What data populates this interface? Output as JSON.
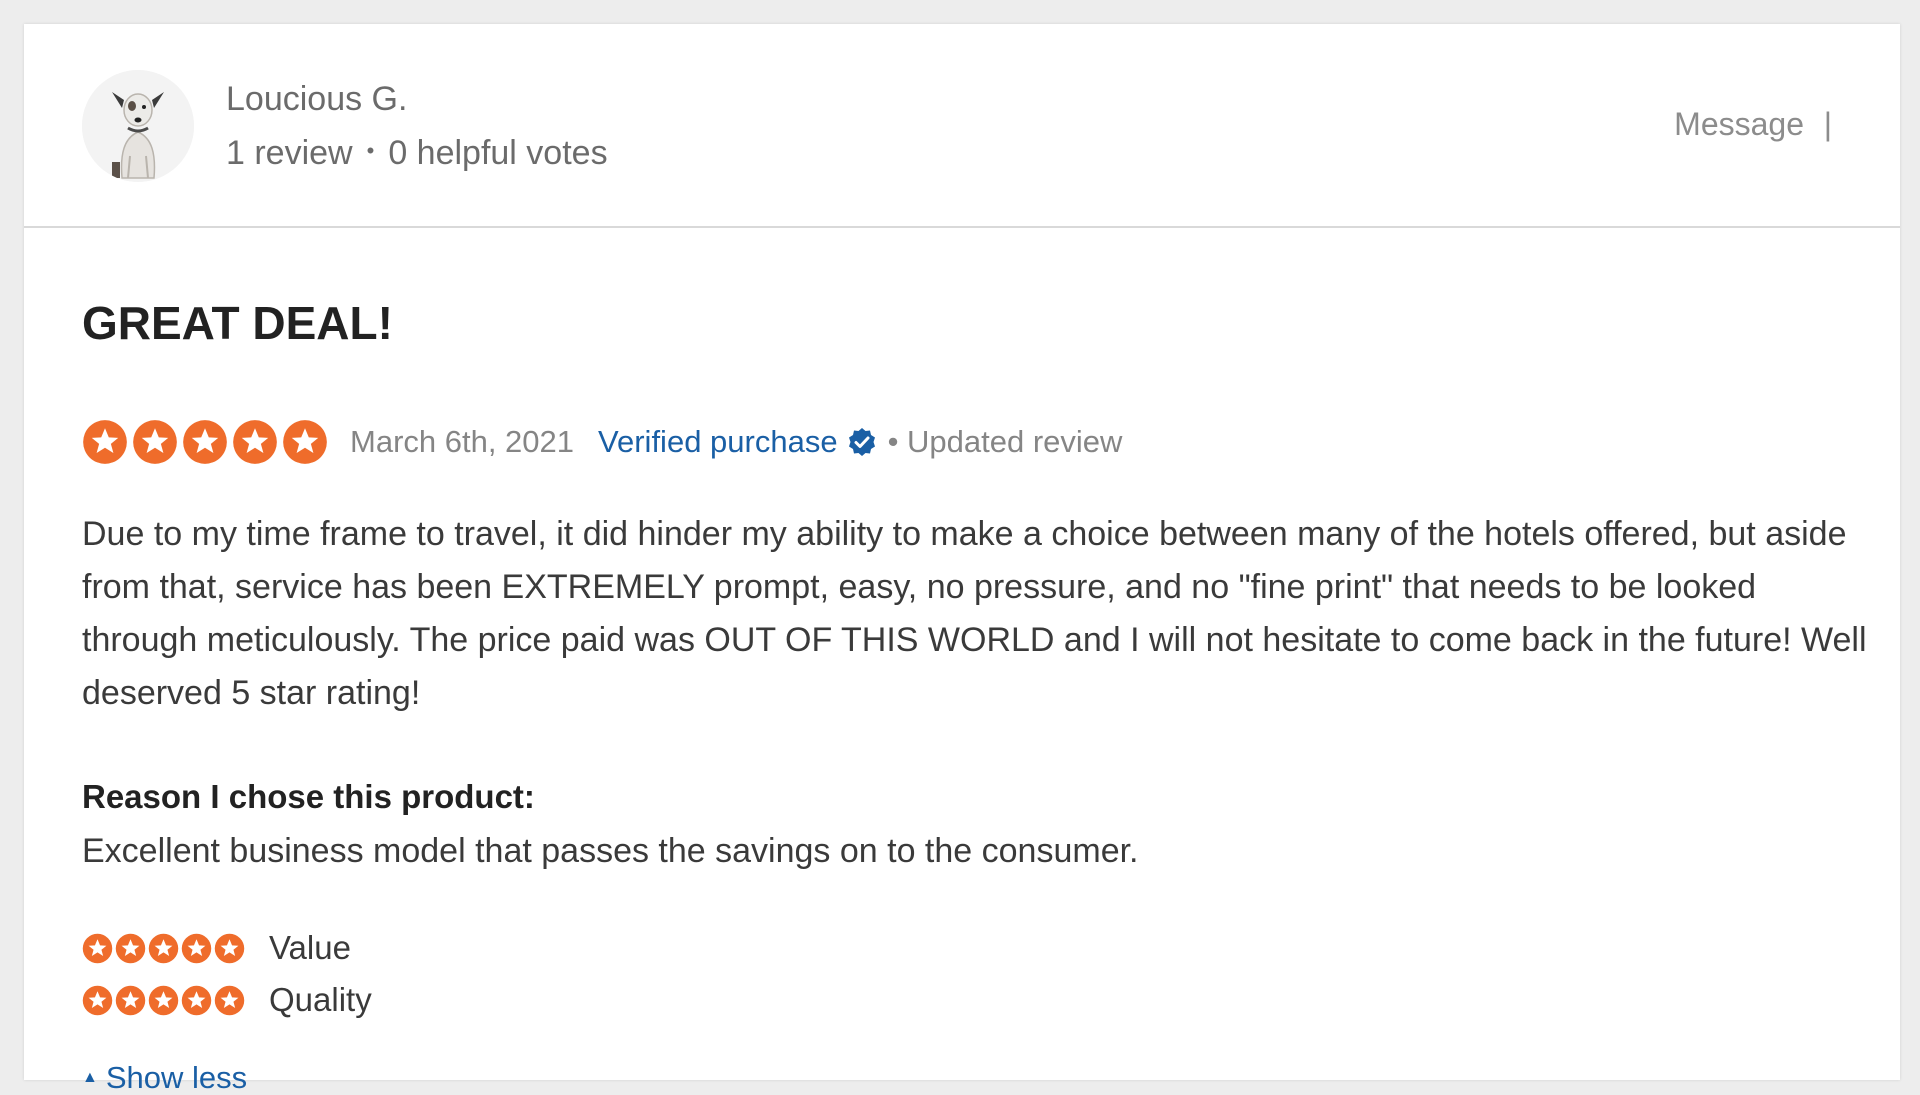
{
  "reviewer": {
    "name": "Loucious G.",
    "reviews": "1 review",
    "separator": "•",
    "helpful_votes": "0 helpful votes",
    "avatar_icon": "dog-avatar-icon"
  },
  "header_actions": {
    "message_label": "Message",
    "divider": "|"
  },
  "review": {
    "title": "GREAT DEAL!",
    "rating": 5,
    "rating_max": 5,
    "date": "March 6th, 2021",
    "verified_label": "Verified purchase",
    "verified_icon": "verified-check-icon",
    "updated_label": "• Updated review",
    "body": "Due to my time frame to travel, it did hinder my ability to make a choice between many of the hotels offered, but aside from that, service has been EXTREMELY prompt, easy, no pressure, and no \"fine print\" that needs to be looked through meticulously. The price paid was OUT OF THIS WORLD and I will not hesitate to come back in the future! Well deserved 5 star rating!",
    "reason_label": "Reason I chose this product:",
    "reason_text": "Excellent business model that passes the savings on to the consumer.",
    "sub_ratings": [
      {
        "label": "Value",
        "rating": 5
      },
      {
        "label": "Quality",
        "rating": 5
      }
    ],
    "show_less_label": "Show less",
    "show_less_icon": "caret-up-icon"
  },
  "colors": {
    "star": "#ef6c2b",
    "link": "#1a5fa5",
    "muted": "#858585",
    "verified_badge": "#1a5fa5"
  }
}
